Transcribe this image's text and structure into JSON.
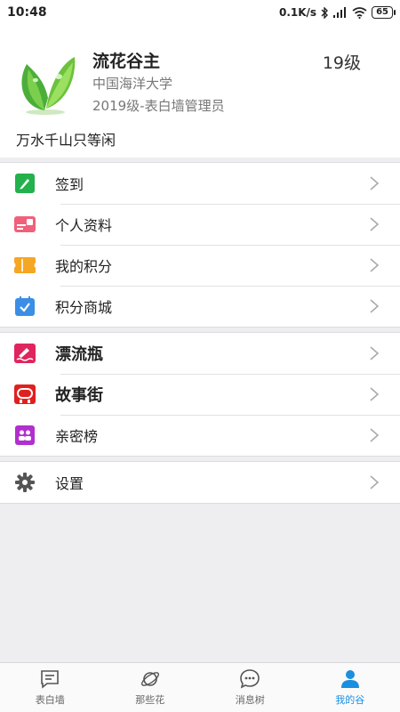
{
  "status_bar": {
    "time": "10:48",
    "net_speed": "0.1K/s",
    "battery": "65"
  },
  "profile": {
    "username": "流花谷主",
    "level": "19级",
    "school": "中国海洋大学",
    "role": "2019级-表白墙管理员",
    "signature": "万水千山只等闲"
  },
  "menu_group1": [
    {
      "label": "签到",
      "icon": "pen-icon",
      "color": "#22b14c"
    },
    {
      "label": "个人资料",
      "icon": "profile-card-icon",
      "color": "#f0607a"
    },
    {
      "label": "我的积分",
      "icon": "ticket-icon",
      "color": "#f5a623"
    },
    {
      "label": "积分商城",
      "icon": "calendar-check-icon",
      "color": "#3a8ee6"
    }
  ],
  "menu_group2": [
    {
      "label": "漂流瓶",
      "icon": "drift-bottle-icon",
      "color": "#e0245e"
    },
    {
      "label": "故事街",
      "icon": "story-icon",
      "color": "#e02020"
    },
    {
      "label": "亲密榜",
      "icon": "intimacy-icon",
      "color": "#b22fcf"
    }
  ],
  "menu_group3": [
    {
      "label": "设置",
      "icon": "gear-icon",
      "color": "#555555"
    }
  ],
  "tabbar": [
    {
      "label": "表白墙",
      "icon": "wall-icon",
      "active": false
    },
    {
      "label": "那些花",
      "icon": "planet-icon",
      "active": false
    },
    {
      "label": "消息树",
      "icon": "chat-icon",
      "active": false
    },
    {
      "label": "我的谷",
      "icon": "user-icon",
      "active": true
    }
  ],
  "colors": {
    "accent": "#1a8fe0"
  }
}
